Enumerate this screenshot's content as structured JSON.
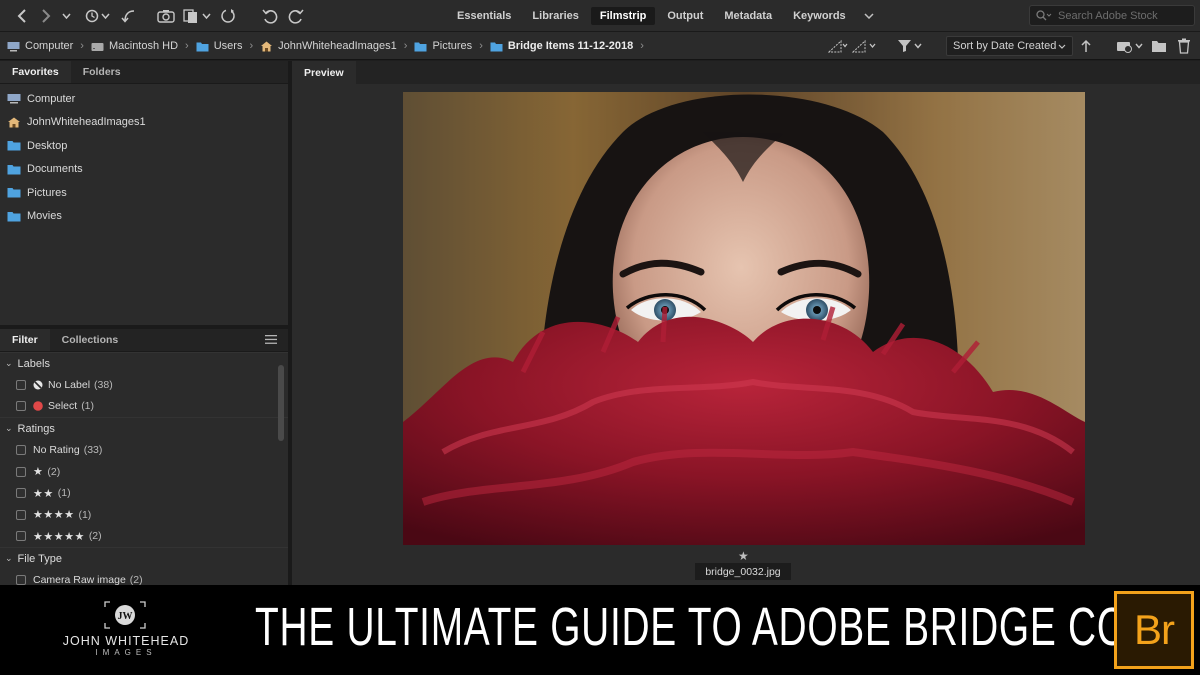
{
  "toolbar": {
    "workspaces": [
      "Essentials",
      "Libraries",
      "Filmstrip",
      "Output",
      "Metadata",
      "Keywords"
    ],
    "active_workspace": "Filmstrip",
    "stock_search_placeholder": "Search Adobe Stock"
  },
  "pathbar": {
    "crumbs": [
      {
        "label": "Computer",
        "icon": "computer-icon"
      },
      {
        "label": "Macintosh HD",
        "icon": "drive-icon"
      },
      {
        "label": "Users",
        "icon": "folder-icon"
      },
      {
        "label": "JohnWhiteheadImages1",
        "icon": "home-icon"
      },
      {
        "label": "Pictures",
        "icon": "folder-icon"
      },
      {
        "label": "Bridge Items 11-12-2018",
        "icon": "folder-icon"
      }
    ],
    "sort_label": "Sort by Date Created"
  },
  "favorites_panel": {
    "tabs": [
      "Favorites",
      "Folders"
    ],
    "items": [
      {
        "label": "Computer",
        "icon": "computer-icon"
      },
      {
        "label": "JohnWhiteheadImages1",
        "icon": "home-icon"
      },
      {
        "label": "Desktop",
        "icon": "folder-icon"
      },
      {
        "label": "Documents",
        "icon": "folder-icon"
      },
      {
        "label": "Pictures",
        "icon": "folder-icon"
      },
      {
        "label": "Movies",
        "icon": "folder-icon"
      }
    ]
  },
  "filter_panel": {
    "tabs": [
      "Filter",
      "Collections"
    ],
    "labels_heading": "Labels",
    "labels": [
      {
        "label": "No Label",
        "count": "(38)"
      },
      {
        "label": "Select",
        "count": "(1)"
      }
    ],
    "ratings_heading": "Ratings",
    "ratings": [
      {
        "label": "No Rating",
        "count": "(33)"
      },
      {
        "label": "★",
        "count": "(2)"
      },
      {
        "label": "★★",
        "count": "(1)"
      },
      {
        "label": "★★★★",
        "count": "(1)"
      },
      {
        "label": "★★★★★",
        "count": "(2)"
      }
    ],
    "filetype_heading": "File Type",
    "filetypes": [
      {
        "label": "Camera Raw image",
        "count": "(2)"
      }
    ]
  },
  "preview": {
    "tab": "Preview",
    "rating_star": "★",
    "filename": "bridge_0032.jpg"
  },
  "banner": {
    "logo_line1": "JOHN WHITEHEAD",
    "logo_line2": "IMAGES",
    "logo_monogram": "JW",
    "title": "THE ULTIMATE GUIDE TO ADOBE BRIDGE CC",
    "app_badge": "Br"
  },
  "colors": {
    "panel": "#2b2b2b",
    "panel_dark": "#232323",
    "folder_blue": "#4fa3e0",
    "select_red": "#e04848",
    "bridge_orange": "#f3a21b"
  }
}
